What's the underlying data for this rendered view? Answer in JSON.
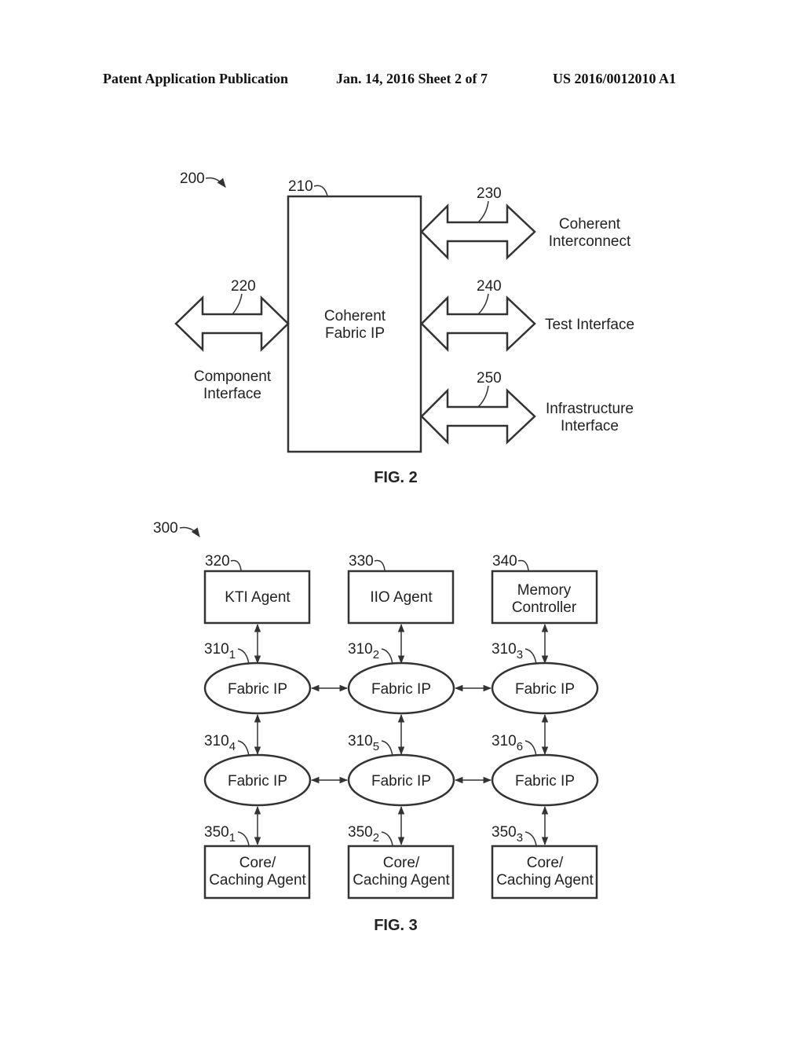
{
  "header": {
    "publication": "Patent Application Publication",
    "date_sheet": "Jan. 14, 2016  Sheet 2 of 7",
    "number": "US 2016/0012010 A1"
  },
  "fig2": {
    "caption": "FIG. 2",
    "ref_main": "200",
    "block": {
      "ref": "210",
      "line1": "Coherent",
      "line2": "Fabric IP"
    },
    "interfaces": [
      {
        "ref": "220",
        "line1": "Component",
        "line2": "Interface"
      },
      {
        "ref": "230",
        "line1": "Coherent",
        "line2": "Interconnect"
      },
      {
        "ref": "240",
        "line1": "Test Interface",
        "line2": ""
      },
      {
        "ref": "250",
        "line1": "Infrastructure",
        "line2": "Interface"
      }
    ]
  },
  "fig3": {
    "caption": "FIG. 3",
    "ref_main": "300",
    "top_blocks": [
      {
        "ref": "320",
        "line1": "KTI Agent",
        "line2": ""
      },
      {
        "ref": "330",
        "line1": "IIO Agent",
        "line2": ""
      },
      {
        "ref": "340",
        "line1": "Memory",
        "line2": "Controller"
      }
    ],
    "fabric_nodes": [
      {
        "ref": "310",
        "sub": "1",
        "label": "Fabric IP"
      },
      {
        "ref": "310",
        "sub": "2",
        "label": "Fabric IP"
      },
      {
        "ref": "310",
        "sub": "3",
        "label": "Fabric IP"
      },
      {
        "ref": "310",
        "sub": "4",
        "label": "Fabric IP"
      },
      {
        "ref": "310",
        "sub": "5",
        "label": "Fabric IP"
      },
      {
        "ref": "310",
        "sub": "6",
        "label": "Fabric IP"
      }
    ],
    "bottom_blocks": [
      {
        "ref": "350",
        "sub": "1",
        "line1": "Core/",
        "line2": "Caching Agent"
      },
      {
        "ref": "350",
        "sub": "2",
        "line1": "Core/",
        "line2": "Caching Agent"
      },
      {
        "ref": "350",
        "sub": "3",
        "line1": "Core/",
        "line2": "Caching Agent"
      }
    ]
  }
}
